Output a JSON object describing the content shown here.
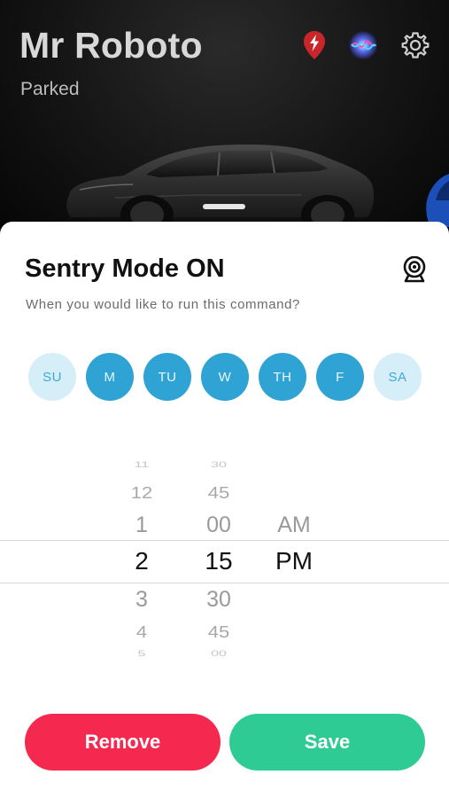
{
  "header": {
    "vehicle_name": "Mr Roboto",
    "status": "Parked",
    "icons": [
      "location-pin-bolt-icon",
      "siri-icon",
      "gear-icon"
    ]
  },
  "sheet": {
    "title": "Sentry Mode ON",
    "subtitle": "When you would like to run this command?",
    "title_icon": "camera-icon"
  },
  "days": [
    {
      "label": "SU",
      "selected": false
    },
    {
      "label": "M",
      "selected": true
    },
    {
      "label": "TU",
      "selected": true
    },
    {
      "label": "W",
      "selected": true
    },
    {
      "label": "TH",
      "selected": true
    },
    {
      "label": "F",
      "selected": true
    },
    {
      "label": "SA",
      "selected": false
    }
  ],
  "time_picker": {
    "hours": [
      "11",
      "12",
      "1",
      "2",
      "3",
      "4",
      "5"
    ],
    "minutes": [
      "30",
      "45",
      "00",
      "15",
      "30",
      "45",
      "00"
    ],
    "ampm": [
      "AM",
      "PM"
    ],
    "selected": {
      "hour": "2",
      "minute": "15",
      "period": "PM"
    }
  },
  "actions": {
    "remove_label": "Remove",
    "save_label": "Save"
  },
  "colors": {
    "day_selected": "#2ea3d4",
    "day_unselected": "#d6eef8",
    "remove": "#f5284f",
    "save": "#2ecb95"
  }
}
